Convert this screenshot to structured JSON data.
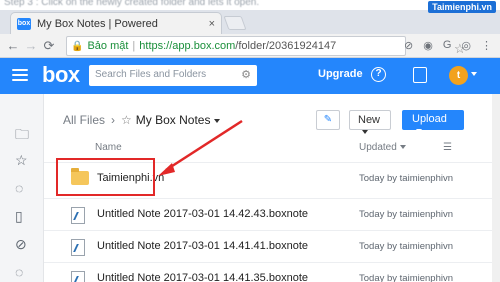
{
  "top_strip": {
    "blur_text": "Step 3 : Click on the newly created folder and lets it open.",
    "watermark": "Taimienphi.vn"
  },
  "browser": {
    "tab_title": "My Box Notes | Powered",
    "tab_favicon": "box",
    "tab_close": "×",
    "secure_label": "Bảo mật",
    "url_host": "https://app.box.com",
    "url_path": "/folder/20361924147"
  },
  "header": {
    "logo": "box",
    "search_placeholder": "Search Files and Folders",
    "upgrade_label": "Upgrade",
    "help_glyph": "?",
    "avatar_letter": "t"
  },
  "breadcrumb": {
    "root": "All Files",
    "current": "My Box Notes"
  },
  "toolbar": {
    "new_label": "New",
    "upload_label": "Upload"
  },
  "columns": {
    "name": "Name",
    "updated": "Updated"
  },
  "rows": [
    {
      "type": "folder",
      "name": "Taimienphi.vn",
      "updated": "Today by taimienphivn"
    },
    {
      "type": "note",
      "name": "Untitled Note 2017-03-01 14.42.43.boxnote",
      "updated": "Today by taimienphivn"
    },
    {
      "type": "note",
      "name": "Untitled Note 2017-03-01 14.41.41.boxnote",
      "updated": "Today by taimienphivn"
    },
    {
      "type": "note",
      "name": "Untitled Note 2017-03-01 14.41.35.boxnote",
      "updated": "Today by taimienphivn"
    }
  ],
  "colors": {
    "box_blue": "#2486fc",
    "highlight_red": "#e22828",
    "folder_yellow": "#f5c65b"
  }
}
